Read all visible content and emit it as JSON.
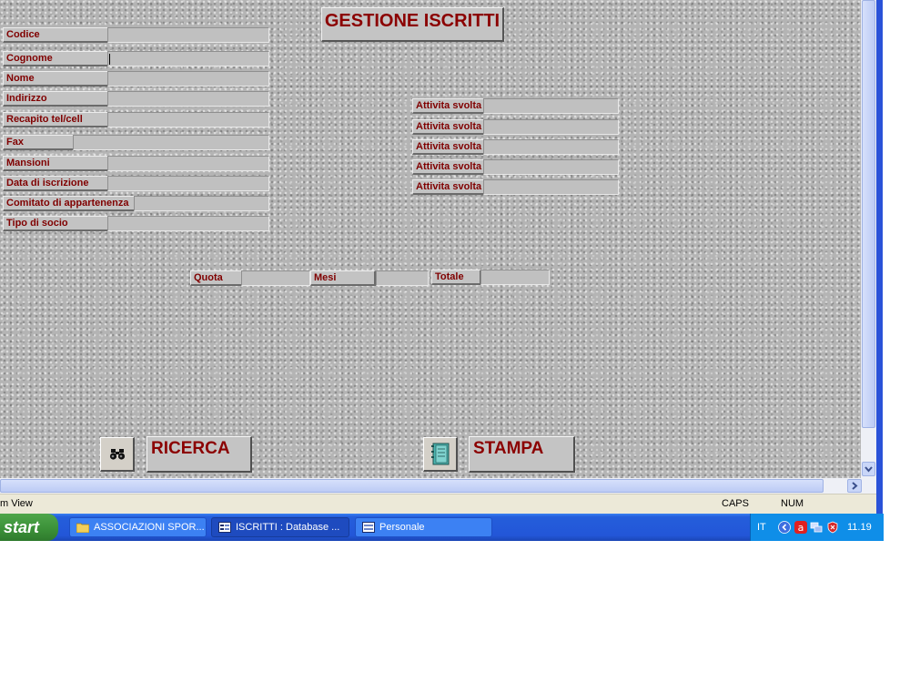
{
  "form": {
    "title": "GESTIONE ISCRITTI",
    "fields": [
      "Codice",
      "Cognome",
      "Nome",
      "Indirizzo",
      "Recapito tel/cell",
      "Fax",
      "Mansioni",
      "Data di iscrizione",
      "Comitato di appartenenza",
      "Tipo di socio"
    ],
    "activities_label": "Attivita svolta",
    "quota_label": "Quota",
    "mesi_label": "Mesi",
    "totale_label": "Totale",
    "search_button": "RICERCA",
    "print_button": "STAMPA"
  },
  "statusbar": {
    "left_text": "m View",
    "caps": "CAPS",
    "num": "NUM"
  },
  "taskbar": {
    "start": "start",
    "tasks": [
      "ASSOCIAZIONI SPOR...",
      "ISCRITTI : Database ...",
      "Personale"
    ],
    "language": "IT",
    "time": "11.19"
  },
  "colors": {
    "label_text": "#800000",
    "taskbar": "#245edb",
    "start_button": "#3a8f37"
  }
}
